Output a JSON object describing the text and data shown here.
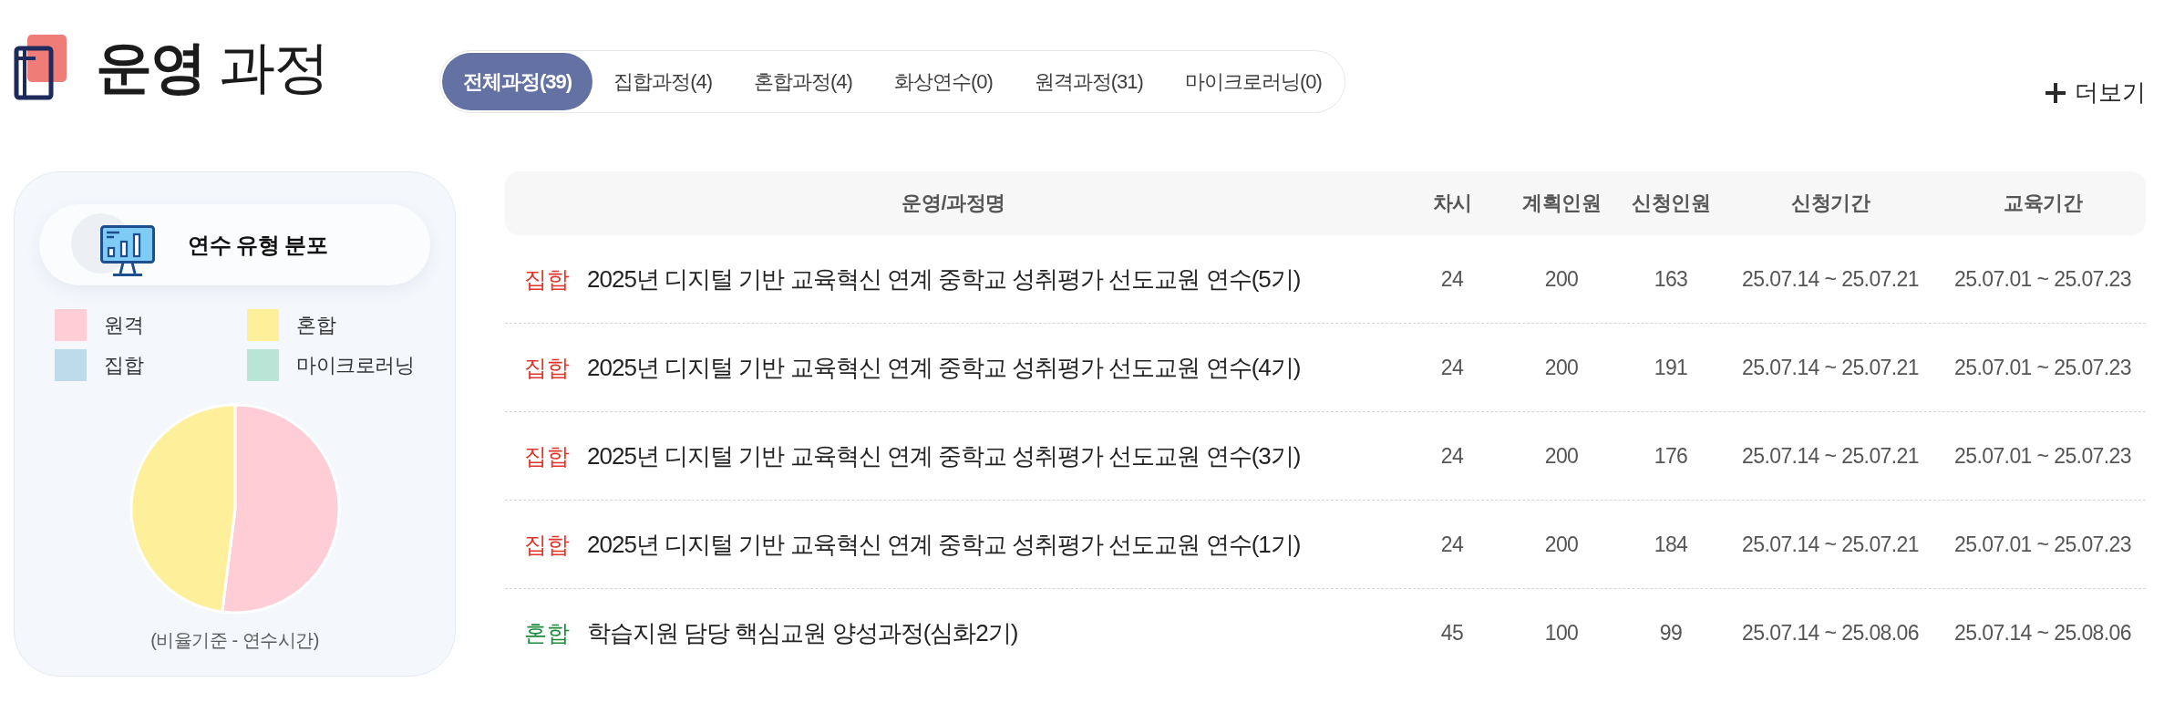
{
  "header": {
    "title": "**운영** 과정",
    "more_link": "더보기"
  },
  "tabs": [
    {
      "label": "전체과정(39)",
      "selected": true
    },
    {
      "label": "집합과정(4)",
      "selected": false
    },
    {
      "label": "혼합과정(4)",
      "selected": false
    },
    {
      "label": "화상연수(0)",
      "selected": false
    },
    {
      "label": "원격과정(31)",
      "selected": false
    },
    {
      "label": "마이크로러닝(0)",
      "selected": false
    }
  ],
  "distribution_panel": {
    "title": "연수 유형 분포",
    "legend": [
      {
        "label": "원격",
        "color": "#fecdd5"
      },
      {
        "label": "혼합",
        "color": "#fef09b"
      },
      {
        "label": "집합",
        "color": "#bddbe9"
      },
      {
        "label": "마이크로러닝",
        "color": "#b9e4d6"
      }
    ],
    "caption": "(비율기준 - 연수시간)"
  },
  "table": {
    "columns": [
      "운영/과정명",
      "차시",
      "계획인원",
      "신청인원",
      "신청기간",
      "교육기간"
    ],
    "rows": [
      {
        "category": "집합",
        "color": "#e0352b",
        "name": "2025년 디지털 기반 교육혁신 연계 중학교 성취평가 선도교원 연수(5기)",
        "sessions": "24",
        "planned": "200",
        "applied": "163",
        "application_period": "25.07.14 ~ 25.07.21",
        "training_period": "25.07.01 ~ 25.07.23"
      },
      {
        "category": "집합",
        "color": "#e0352b",
        "name": "2025년 디지털 기반 교육혁신 연계 중학교 성취평가 선도교원 연수(4기)",
        "sessions": "24",
        "planned": "200",
        "applied": "191",
        "application_period": "25.07.14 ~ 25.07.21",
        "training_period": "25.07.01 ~ 25.07.23"
      },
      {
        "category": "집합",
        "color": "#e0352b",
        "name": "2025년 디지털 기반 교육혁신 연계 중학교 성취평가 선도교원 연수(3기)",
        "sessions": "24",
        "planned": "200",
        "applied": "176",
        "application_period": "25.07.14 ~ 25.07.21",
        "training_period": "25.07.01 ~ 25.07.23"
      },
      {
        "category": "집합",
        "color": "#e0352b",
        "name": "2025년 디지털 기반 교육혁신 연계 중학교 성취평가 선도교원 연수(1기)",
        "sessions": "24",
        "planned": "200",
        "applied": "184",
        "application_period": "25.07.14 ~ 25.07.21",
        "training_period": "25.07.01 ~ 25.07.23"
      },
      {
        "category": "혼합",
        "color": "#1e8a3c",
        "name": "학습지원 담당 핵심교원 양성과정(심화2기)",
        "sessions": "45",
        "planned": "100",
        "applied": "99",
        "application_period": "25.07.14 ~ 25.08.06",
        "training_period": "25.07.14 ~ 25.08.06"
      }
    ]
  }
}
